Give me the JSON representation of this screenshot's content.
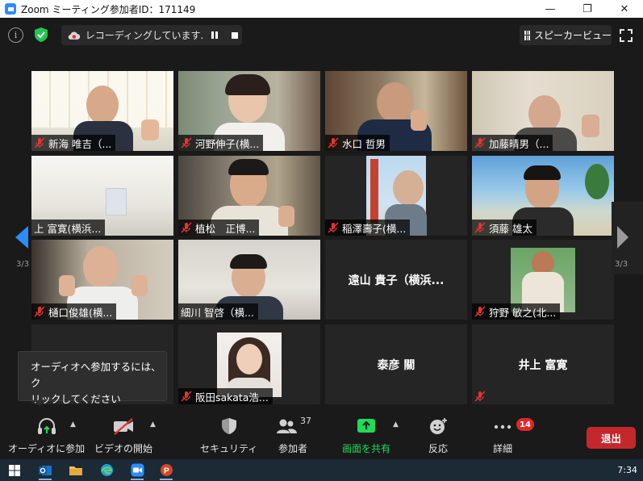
{
  "window": {
    "title": "Zoom ミーティング参加者ID：171149",
    "controls": {
      "minimize": "—",
      "restore": "❐",
      "close": "✕"
    }
  },
  "topbar": {
    "info_icon": "info-icon",
    "security_icon": "shield-check-icon",
    "recording_text": "レコーディングしています...",
    "speaker_view_label": "スピーカービュー",
    "fullscreen_icon": "fullscreen-icon"
  },
  "participants": [
    {
      "name": "新海 唯吉（...",
      "muted": true,
      "video": true
    },
    {
      "name": "河野伸子(横...",
      "muted": true,
      "video": true
    },
    {
      "name": "水口 哲男",
      "muted": true,
      "video": true
    },
    {
      "name": "加藤晴男（...",
      "muted": true,
      "video": true
    },
    {
      "name": "上 富寛(横浜...",
      "muted": false,
      "video": true
    },
    {
      "name": "植松　正博...",
      "muted": true,
      "video": true
    },
    {
      "name": "稲澤壽子(横...",
      "muted": true,
      "video": true
    },
    {
      "name": "須藤 雄太",
      "muted": true,
      "video": true
    },
    {
      "name": "樋口俊雄(横...",
      "muted": true,
      "video": true
    },
    {
      "name": "細川 智啓（横...",
      "muted": false,
      "video": true
    },
    {
      "name": "遠山 貴子（横浜...",
      "muted": false,
      "video": false
    },
    {
      "name": "狩野 敏之(北...",
      "muted": true,
      "video": true
    },
    {
      "name": "",
      "muted": false,
      "video": false
    },
    {
      "name": "阪田sakata浩...",
      "muted": true,
      "video": true
    },
    {
      "name": "泰彦 關",
      "muted": false,
      "video": false
    },
    {
      "name": "井上 富寛",
      "muted": true,
      "video": false
    }
  ],
  "pagination": {
    "left": "3/3",
    "right": "3/3"
  },
  "tooltip": {
    "line1": "オーディオへ参加するには、ク",
    "line2": "リックしてください"
  },
  "toolbar": {
    "audio_label": "オーディオに参加",
    "video_label": "ビデオの開始",
    "security_label": "セキュリティ",
    "participants_label": "参加者",
    "participants_count": "37",
    "share_label": "画面を共有",
    "reactions_label": "反応",
    "more_label": "詳細",
    "more_badge": "14",
    "leave_label": "退出",
    "colors": {
      "share": "#23d959",
      "leave": "#c4282c",
      "badge": "#e02828"
    }
  },
  "taskbar": {
    "apps": [
      "windows-start-icon",
      "outlook-icon",
      "file-explorer-icon",
      "edge-icon",
      "zoom-icon",
      "powerpoint-icon"
    ],
    "clock": "7:34"
  }
}
